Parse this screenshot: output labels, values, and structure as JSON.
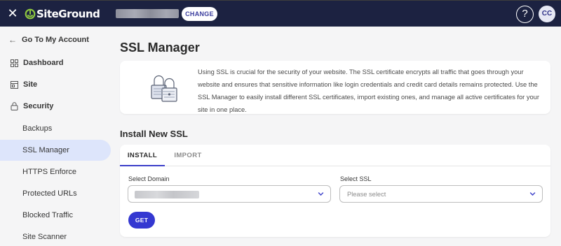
{
  "topbar": {
    "brand": "SiteGround",
    "change_label": "CHANGE",
    "help_label": "?",
    "avatar_initials": "CC",
    "bar_color": "#1c2241",
    "brand_accent": "#8dc63f"
  },
  "sidebar": {
    "back_label": "Go To My Account",
    "items": [
      {
        "label": "Dashboard",
        "icon": "grid-icon"
      },
      {
        "label": "Site",
        "icon": "site-icon"
      },
      {
        "label": "Security",
        "icon": "lock-icon"
      }
    ],
    "sub_items": [
      {
        "label": "Backups"
      },
      {
        "label": "SSL Manager",
        "active": true
      },
      {
        "label": "HTTPS Enforce"
      },
      {
        "label": "Protected URLs"
      },
      {
        "label": "Blocked Traffic"
      },
      {
        "label": "Site Scanner"
      }
    ]
  },
  "main": {
    "title": "SSL Manager",
    "info_text": "Using SSL is crucial for the security of your website. The SSL certificate encrypts all traffic that goes through your website and ensures that sensitive information like login credentials and credit card details remains protected. Use the SSL Manager to easily install different SSL certificates, import existing ones, and manage all active certificates for your site in one place.",
    "install_title": "Install New SSL",
    "tabs": [
      {
        "label": "INSTALL",
        "active": true
      },
      {
        "label": "IMPORT",
        "active": false
      }
    ],
    "form": {
      "domain_label": "Select Domain",
      "ssl_label": "Select SSL",
      "ssl_placeholder": "Please select",
      "submit_label": "GET"
    },
    "accent_color": "#3438d1"
  }
}
